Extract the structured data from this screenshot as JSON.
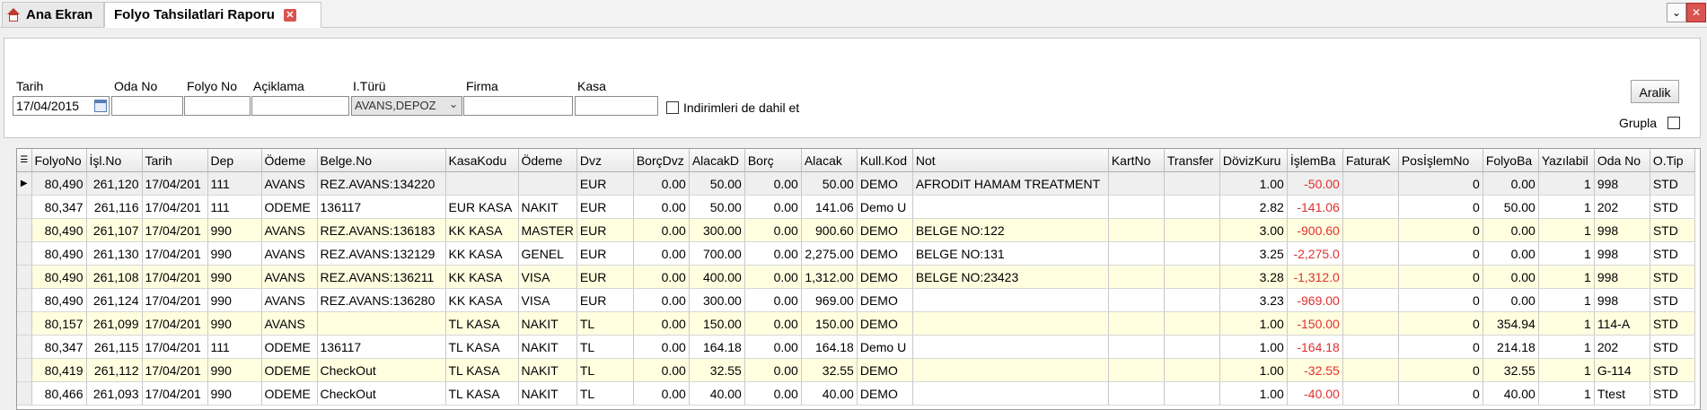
{
  "tabs": [
    {
      "label": "Ana Ekran"
    },
    {
      "label": "Folyo Tahsilatlari Raporu"
    }
  ],
  "filters": {
    "tarih": {
      "label": "Tarih",
      "value": "17/04/2015"
    },
    "oda": {
      "label": "Oda No",
      "value": ""
    },
    "folyo": {
      "label": "Folyo No",
      "value": ""
    },
    "aciklama": {
      "label": "Açiklama",
      "value": ""
    },
    "turu": {
      "label": "I.Türü",
      "value": "AVANS,DEPOZ"
    },
    "firma": {
      "label": "Firma",
      "value": ""
    },
    "kasa": {
      "label": "Kasa",
      "value": ""
    },
    "indirim": {
      "label": "Indirimleri de dahil et",
      "checked": false
    },
    "aralik_button": "Aralik",
    "grupla": {
      "label": "Grupla",
      "checked": false
    }
  },
  "grid": {
    "columns": [
      "FolyoNo",
      "İşl.No",
      "Tarih",
      "Dep",
      "Ödeme",
      "Belge.No",
      "KasaKodu",
      "Ödeme",
      "Dvz",
      "BorçDvz",
      "AlacakD",
      "Borç",
      "Alacak",
      "Kull.Kod",
      "Not",
      "KartNo",
      "Transfer",
      "DövizKuru",
      "İşlemBa",
      "FaturaK",
      "PosİşlemNo",
      "FolyoBa",
      "Yazılabil",
      "Oda No",
      "O.Tip"
    ],
    "rows": [
      [
        "80,490",
        "261,120",
        "17/04/201",
        "111",
        "AVANS",
        "REZ.AVANS:134220",
        "",
        "",
        "EUR",
        "0.00",
        "50.00",
        "0.00",
        "50.00",
        "DEMO",
        "AFRODIT HAMAM TREATMENT",
        "",
        "",
        "1.00",
        "-50.00",
        "",
        "0",
        "0.00",
        "1",
        "998",
        "STD"
      ],
      [
        "80,347",
        "261,116",
        "17/04/201",
        "111",
        "ODEME",
        "136117",
        "EUR KASA",
        "NAKIT",
        "EUR",
        "0.00",
        "50.00",
        "0.00",
        "141.06",
        "Demo U",
        "",
        "",
        "",
        "2.82",
        "-141.06",
        "",
        "0",
        "50.00",
        "1",
        "202",
        "STD"
      ],
      [
        "80,490",
        "261,107",
        "17/04/201",
        "990",
        "AVANS",
        "REZ.AVANS:136183",
        "KK KASA",
        "MASTER",
        "EUR",
        "0.00",
        "300.00",
        "0.00",
        "900.60",
        "DEMO",
        "BELGE NO:122",
        "",
        "",
        "3.00",
        "-900.60",
        "",
        "0",
        "0.00",
        "1",
        "998",
        "STD"
      ],
      [
        "80,490",
        "261,130",
        "17/04/201",
        "990",
        "AVANS",
        "REZ.AVANS:132129",
        "KK KASA",
        "GENEL",
        "EUR",
        "0.00",
        "700.00",
        "0.00",
        "2,275.00",
        "DEMO",
        "BELGE NO:131",
        "",
        "",
        "3.25",
        "-2,275.0",
        "",
        "0",
        "0.00",
        "1",
        "998",
        "STD"
      ],
      [
        "80,490",
        "261,108",
        "17/04/201",
        "990",
        "AVANS",
        "REZ.AVANS:136211",
        "KK KASA",
        "VISA",
        "EUR",
        "0.00",
        "400.00",
        "0.00",
        "1,312.00",
        "DEMO",
        "BELGE NO:23423",
        "",
        "",
        "3.28",
        "-1,312.0",
        "",
        "0",
        "0.00",
        "1",
        "998",
        "STD"
      ],
      [
        "80,490",
        "261,124",
        "17/04/201",
        "990",
        "AVANS",
        "REZ.AVANS:136280",
        "KK KASA",
        "VISA",
        "EUR",
        "0.00",
        "300.00",
        "0.00",
        "969.00",
        "DEMO",
        "",
        "",
        "",
        "3.23",
        "-969.00",
        "",
        "0",
        "0.00",
        "1",
        "998",
        "STD"
      ],
      [
        "80,157",
        "261,099",
        "17/04/201",
        "990",
        "AVANS",
        "",
        "TL KASA",
        "NAKIT",
        "TL",
        "0.00",
        "150.00",
        "0.00",
        "150.00",
        "DEMO",
        "",
        "",
        "",
        "1.00",
        "-150.00",
        "",
        "0",
        "354.94",
        "1",
        "114-A",
        "STD"
      ],
      [
        "80,347",
        "261,115",
        "17/04/201",
        "111",
        "ODEME",
        "136117",
        "TL KASA",
        "NAKIT",
        "TL",
        "0.00",
        "164.18",
        "0.00",
        "164.18",
        "Demo U",
        "",
        "",
        "",
        "1.00",
        "-164.18",
        "",
        "0",
        "214.18",
        "1",
        "202",
        "STD"
      ],
      [
        "80,419",
        "261,112",
        "17/04/201",
        "990",
        "ODEME",
        "CheckOut",
        "TL KASA",
        "NAKIT",
        "TL",
        "0.00",
        "32.55",
        "0.00",
        "32.55",
        "DEMO",
        "",
        "",
        "",
        "1.00",
        "-32.55",
        "",
        "0",
        "32.55",
        "1",
        "G-114",
        "STD"
      ],
      [
        "80,466",
        "261,093",
        "17/04/201",
        "990",
        "ODEME",
        "CheckOut",
        "TL KASA",
        "NAKIT",
        "TL",
        "0.00",
        "40.00",
        "0.00",
        "40.00",
        "DEMO",
        "",
        "",
        "",
        "1.00",
        "-40.00",
        "",
        "0",
        "40.00",
        "1",
        "Ttest",
        "STD"
      ]
    ]
  }
}
